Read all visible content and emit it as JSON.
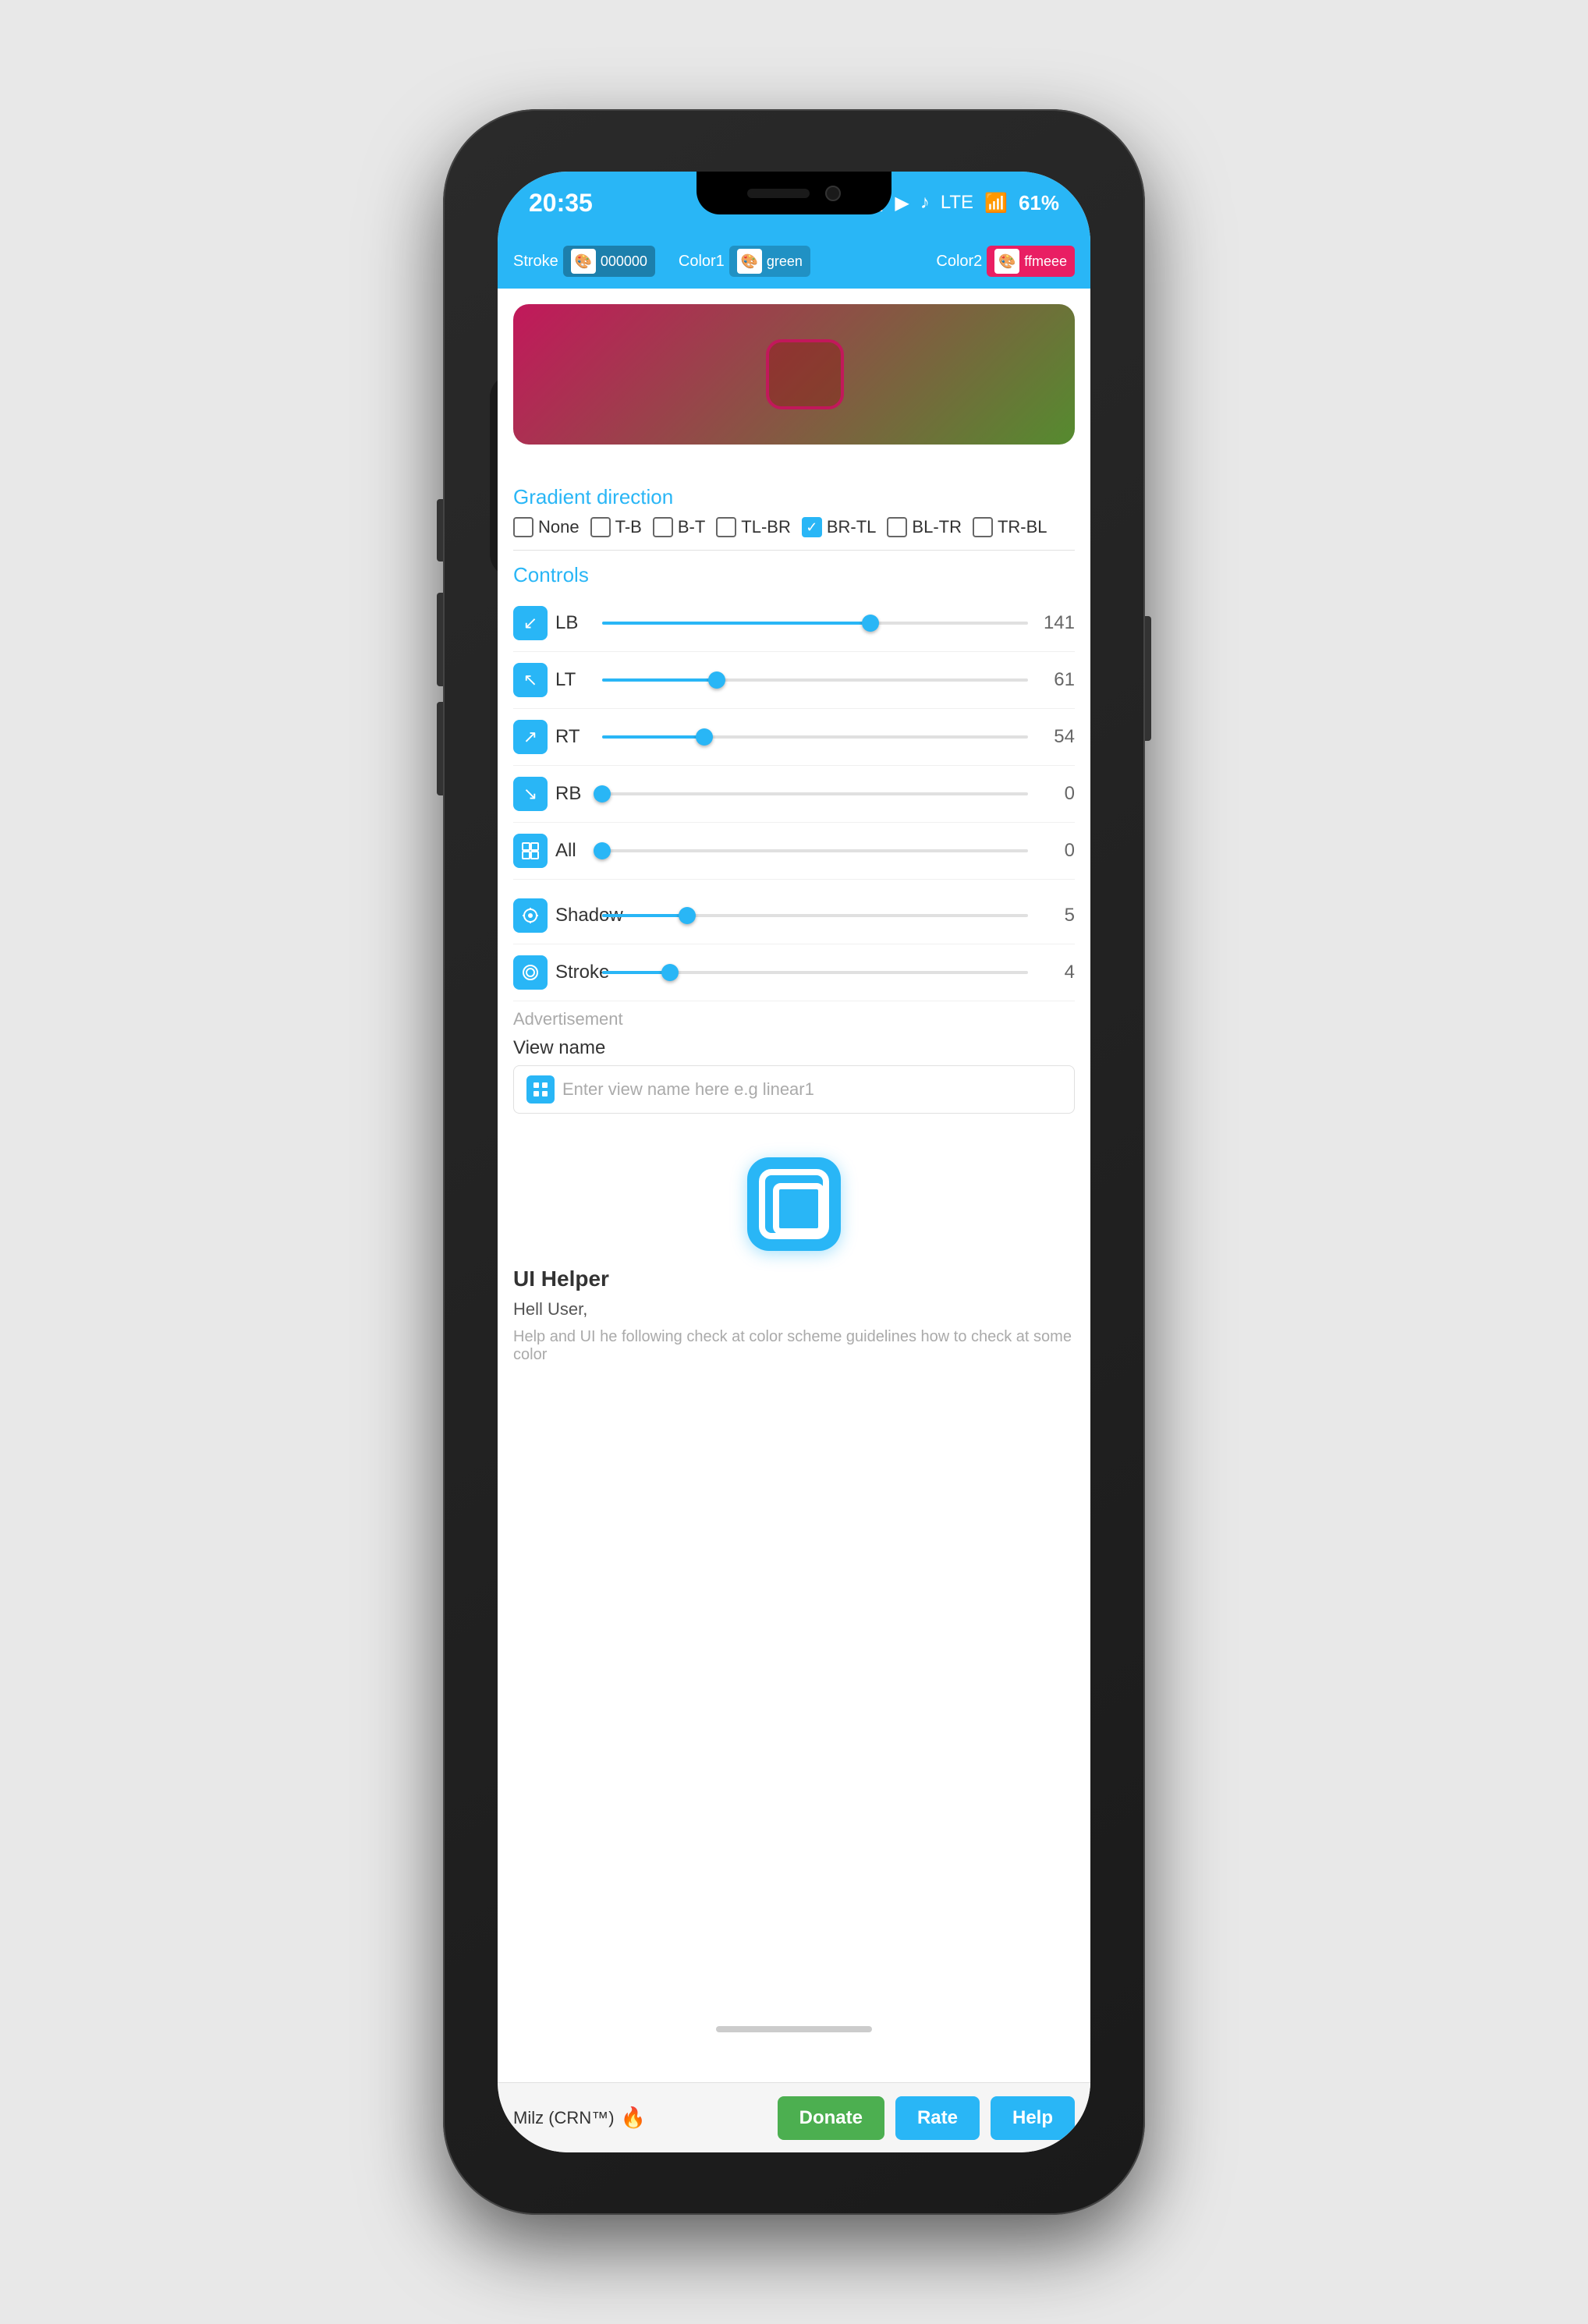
{
  "status": {
    "time": "20:35",
    "battery": "61%",
    "signal": "LTE"
  },
  "toolbar": {
    "stroke_label": "Stroke",
    "color1_label": "Color1",
    "color2_label": "Color2",
    "stroke_value": "000000",
    "color1_value": "green",
    "color2_value": "ffmeee"
  },
  "gradient": {
    "section_title": "Gradient direction",
    "directions": [
      {
        "id": "none",
        "label": "None",
        "checked": false
      },
      {
        "id": "tb",
        "label": "T-B",
        "checked": false
      },
      {
        "id": "bt",
        "label": "B-T",
        "checked": false
      },
      {
        "id": "tlbr",
        "label": "TL-BR",
        "checked": false
      },
      {
        "id": "brtl",
        "label": "BR-TL",
        "checked": true
      },
      {
        "id": "bltr",
        "label": "BL-TR",
        "checked": false
      },
      {
        "id": "trbl",
        "label": "TR-BL",
        "checked": false
      }
    ]
  },
  "controls": {
    "section_title": "Controls",
    "items": [
      {
        "id": "lb",
        "label": "LB",
        "value": 141,
        "percent": 63,
        "icon": "↙"
      },
      {
        "id": "lt",
        "label": "LT",
        "value": 61,
        "percent": 27,
        "icon": "↖"
      },
      {
        "id": "rt",
        "label": "RT",
        "value": 54,
        "percent": 24,
        "icon": "↗"
      },
      {
        "id": "rb",
        "label": "RB",
        "value": 0,
        "percent": 0,
        "icon": "↘"
      },
      {
        "id": "all",
        "label": "All",
        "value": 0,
        "percent": 0,
        "icon": "⊞"
      }
    ],
    "shadow_label": "Shadow",
    "shadow_value": 5,
    "shadow_percent": 20,
    "stroke_label": "Stroke",
    "stroke_value": 4,
    "stroke_percent": 16
  },
  "advertisement": {
    "label": "Advertisement"
  },
  "view_name": {
    "label": "View name",
    "placeholder": "Enter view name here e.g linear1"
  },
  "ui_helper": {
    "title": "UI Helper",
    "greeting": "Hell User,",
    "subtext": "Help and UI he following check at color scheme guidelines how to check at some color"
  },
  "bottom": {
    "author": "Milz (CRN™)",
    "donate_label": "Donate",
    "rate_label": "Rate",
    "help_label": "Help"
  }
}
